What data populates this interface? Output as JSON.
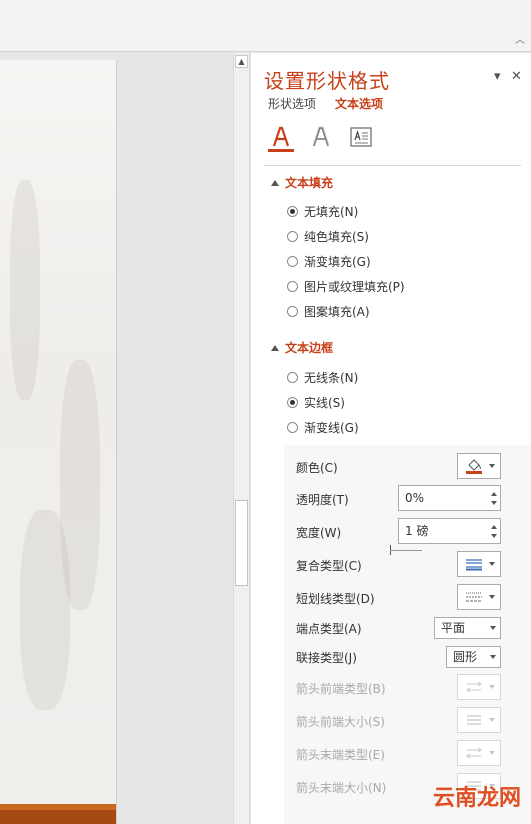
{
  "pane": {
    "title": "设置形状格式",
    "tabs": [
      {
        "label": "形状选项",
        "active": false
      },
      {
        "label": "文本选项",
        "active": true
      }
    ],
    "categories": [
      "text-fill-outline-icon",
      "text-effects-icon",
      "textbox-icon"
    ]
  },
  "text_fill": {
    "heading": "文本填充",
    "options": [
      {
        "label": "无填充(N)",
        "selected": true
      },
      {
        "label": "纯色填充(S)",
        "selected": false
      },
      {
        "label": "渐变填充(G)",
        "selected": false
      },
      {
        "label": "图片或纹理填充(P)",
        "selected": false
      },
      {
        "label": "图案填充(A)",
        "selected": false
      }
    ]
  },
  "text_outline": {
    "heading": "文本边框",
    "options": [
      {
        "label": "无线条(N)",
        "selected": false
      },
      {
        "label": "实线(S)",
        "selected": true
      },
      {
        "label": "渐变线(G)",
        "selected": false
      }
    ],
    "props": {
      "color_label": "颜色(C)",
      "transparency_label": "透明度(T)",
      "transparency_value": "0%",
      "width_label": "宽度(W)",
      "width_value": "1 磅",
      "compound_label": "复合类型(C)",
      "dash_label": "短划线类型(D)",
      "cap_label": "端点类型(A)",
      "cap_value": "平面",
      "join_label": "联接类型(J)",
      "join_value": "圆形",
      "arrow_begin_type_label": "箭头前端类型(B)",
      "arrow_begin_size_label": "箭头前端大小(S)",
      "arrow_end_type_label": "箭头末端类型(E)",
      "arrow_end_size_label": "箭头末端大小(N)"
    }
  },
  "watermark": "云南龙网",
  "colors": {
    "accent": "#c8401a",
    "slide_bar": "#a44a12"
  }
}
